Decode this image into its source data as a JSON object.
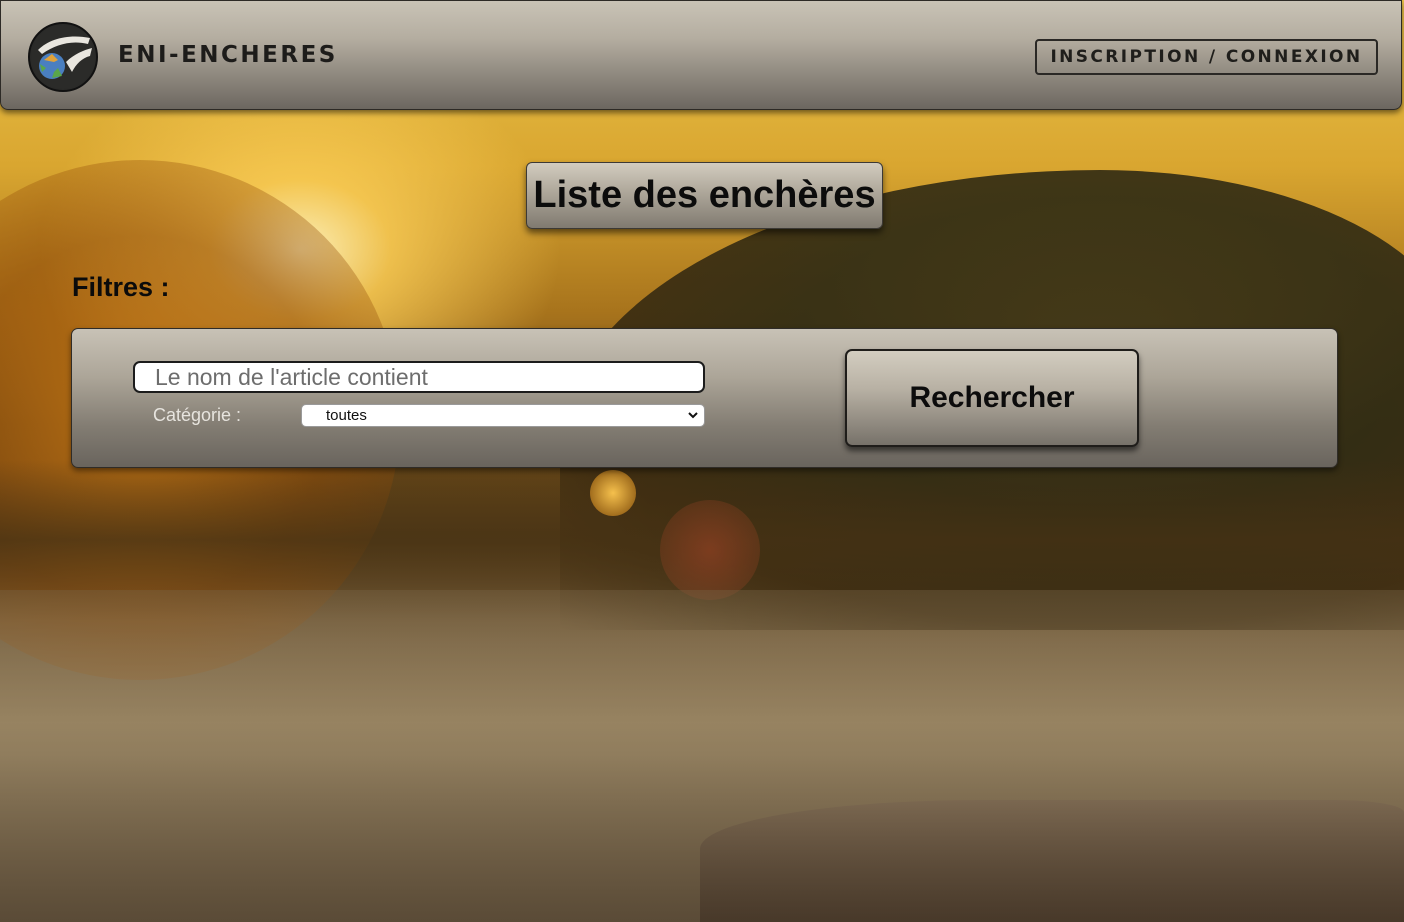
{
  "header": {
    "brand": "ENI-ENCHERES",
    "logo_icon": "recycle-globe-logo-icon",
    "auth_link": "INSCRIPTION / CONNEXION"
  },
  "main": {
    "title": "Liste des enchères",
    "filters_label": "Filtres :",
    "search": {
      "placeholder": "Le nom de l'article contient",
      "value": ""
    },
    "category": {
      "label": "Catégorie :",
      "selected": "toutes",
      "chevron_icon": "chevron-down-icon"
    },
    "search_button": "Rechercher"
  },
  "colors": {
    "panel_top": "#c8c2b6",
    "panel_bottom": "#69645d",
    "text_dark": "#0c0c0c",
    "category_label": "#e7e4de",
    "background_sky": "#e9c24a"
  }
}
